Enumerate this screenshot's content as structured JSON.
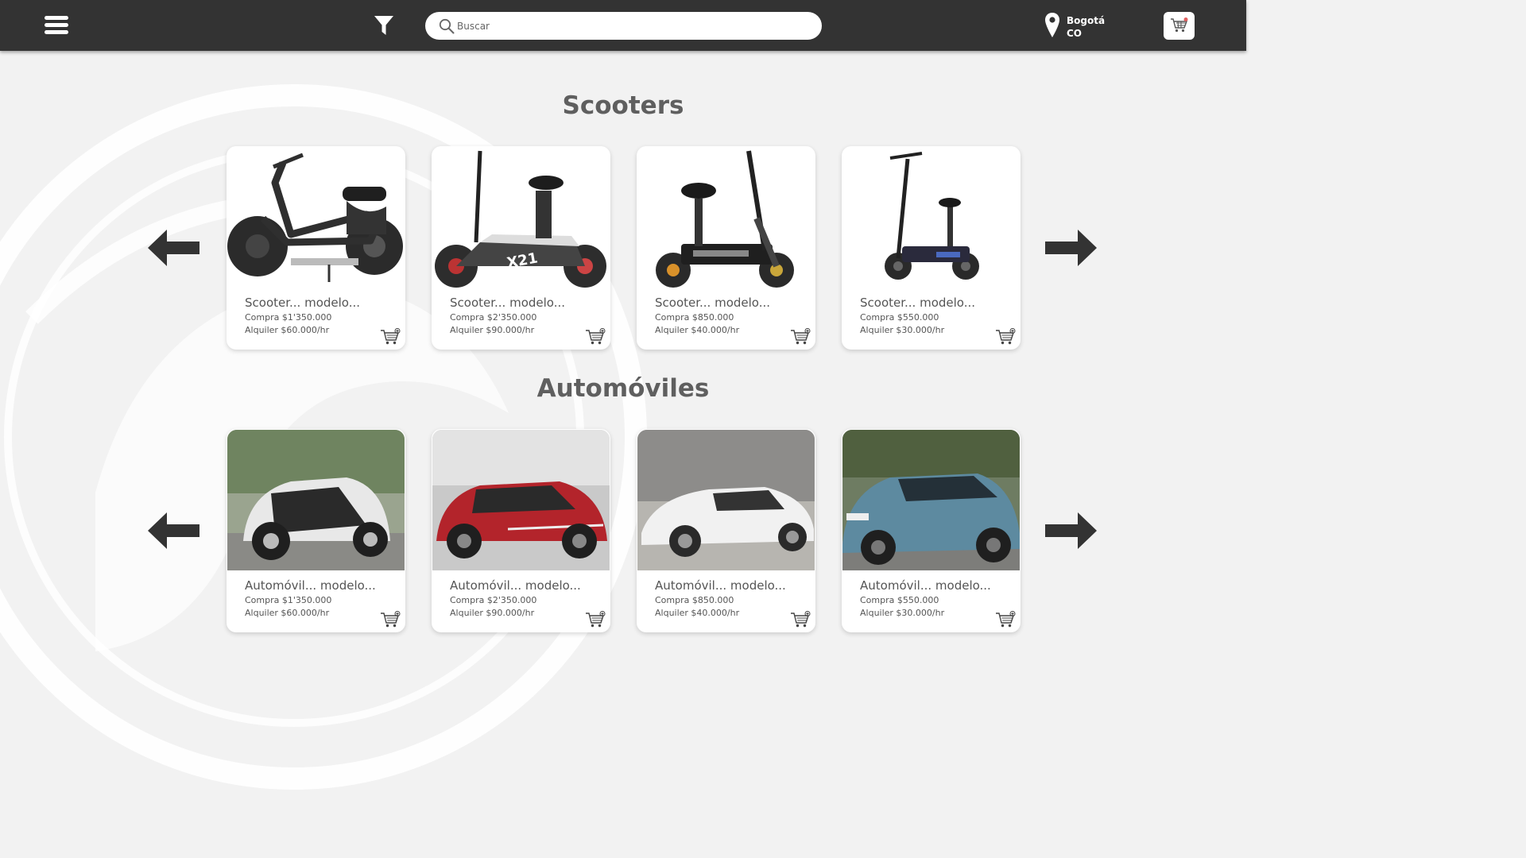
{
  "header": {
    "search_placeholder": "Buscar",
    "location_city": "Bogotá",
    "location_country": "CO"
  },
  "sections": [
    {
      "title": "Scooters",
      "products": [
        {
          "name": "Scooter... modelo...",
          "buy": "Compra $1'350.000",
          "rent": "Alquiler $60.000/hr"
        },
        {
          "name": "Scooter... modelo...",
          "buy": "Compra $2'350.000",
          "rent": "Alquiler $90.000/hr"
        },
        {
          "name": "Scooter... modelo...",
          "buy": "Compra $850.000",
          "rent": "Alquiler $40.000/hr"
        },
        {
          "name": "Scooter... modelo...",
          "buy": "Compra $550.000",
          "rent": "Alquiler $30.000/hr"
        }
      ]
    },
    {
      "title": "Automóviles",
      "products": [
        {
          "name": "Automóvil... modelo...",
          "buy": "Compra $1'350.000",
          "rent": "Alquiler $60.000/hr"
        },
        {
          "name": "Automóvil... modelo...",
          "buy": "Compra $2'350.000",
          "rent": "Alquiler $90.000/hr"
        },
        {
          "name": "Automóvil... modelo...",
          "buy": "Compra $850.000",
          "rent": "Alquiler $40.000/hr"
        },
        {
          "name": "Automóvil... modelo...",
          "buy": "Compra $550.000",
          "rent": "Alquiler $30.000/hr"
        }
      ]
    }
  ],
  "icons": {
    "menu": "menu-icon",
    "filter": "filter-icon",
    "search": "search-icon",
    "location": "location-pin-icon",
    "cart": "shopping-cart-icon",
    "add_to_cart": "add-to-cart-icon",
    "previous": "arrow-left-icon",
    "next": "arrow-right-icon"
  },
  "colors": {
    "header_bg": "#333333",
    "page_bg": "#f2f2f2",
    "title_text": "#5f5f5f",
    "cart_badge": "#e06060"
  }
}
